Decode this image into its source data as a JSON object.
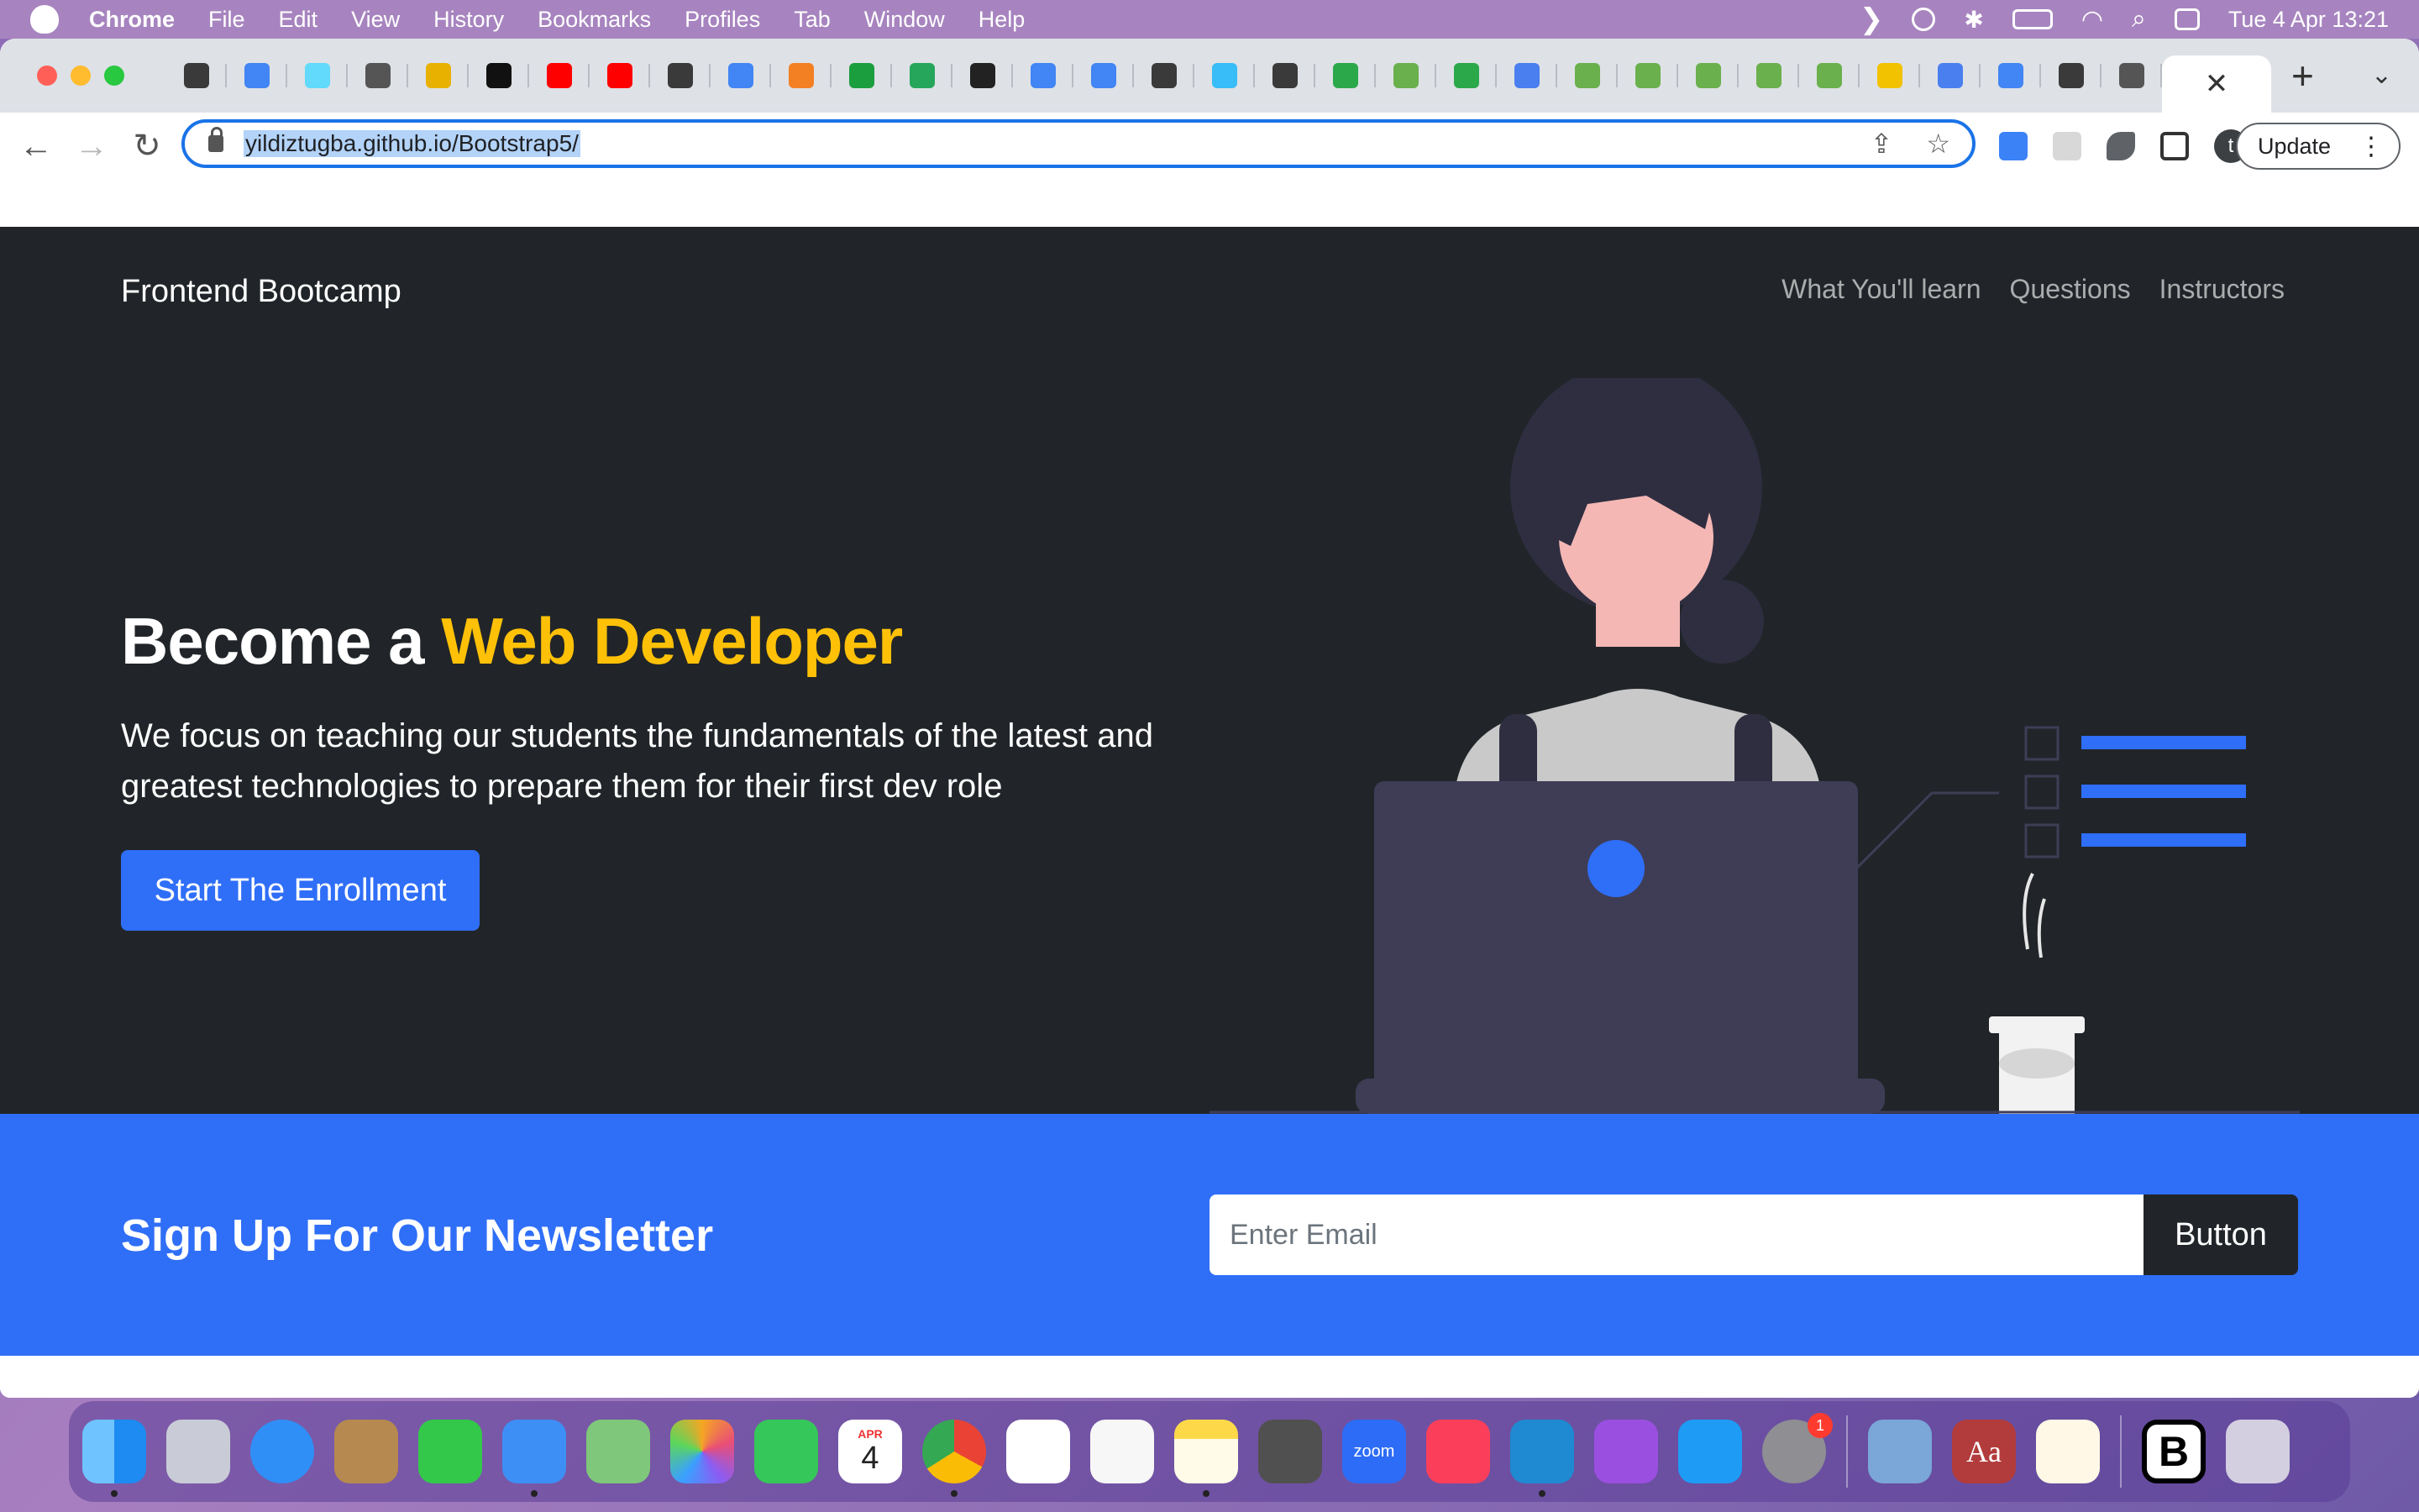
{
  "menubar": {
    "app": "Chrome",
    "items": [
      "File",
      "Edit",
      "View",
      "History",
      "Bookmarks",
      "Profiles",
      "Tab",
      "Window",
      "Help"
    ],
    "clock": "Tue 4 Apr  13:21"
  },
  "browser": {
    "tab_count": 33,
    "active_tab_close": "✕",
    "new_tab": "+",
    "url": "yildiztugba.github.io/Bootstrap5/",
    "update_label": "Update",
    "profile_initial": "t"
  },
  "site": {
    "brand": "Frontend Bootcamp",
    "nav": [
      "What You'll learn",
      "Questions",
      "Instructors"
    ],
    "hero": {
      "title_prefix": "Become a ",
      "title_accent": "Web Developer",
      "lead": "We focus on teaching our students the fundamentals of the latest and greatest technologies to prepare them for their first dev role",
      "cta": "Start The Enrollment"
    },
    "newsletter": {
      "title": "Sign Up For Our Newsletter",
      "email_placeholder": "Enter Email",
      "button": "Button"
    }
  },
  "dock": {
    "calendar_month": "APR",
    "calendar_day": "4",
    "settings_badge": "1",
    "zoom_label": "zoom",
    "dictionary_label": "Aa",
    "bootstrap_label": "B"
  },
  "colors": {
    "hero_bg": "#212529",
    "accent": "#ffc107",
    "primary": "#2f6ef7"
  }
}
